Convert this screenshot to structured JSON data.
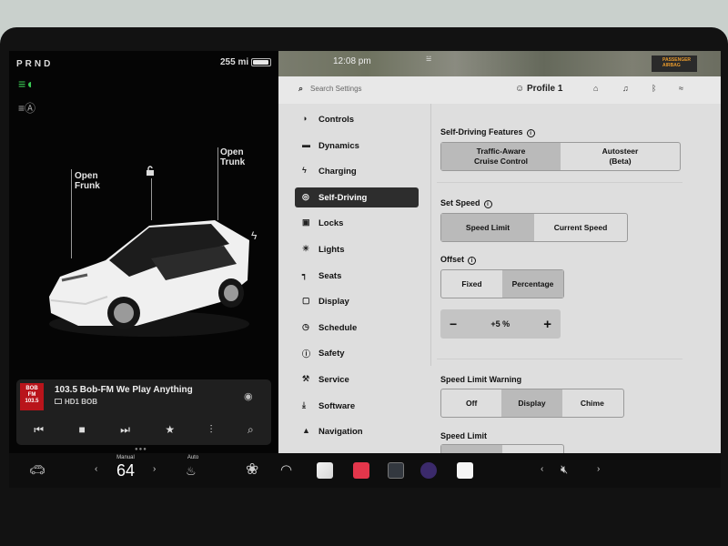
{
  "status": {
    "gear": "PRND",
    "range": "255 mi"
  },
  "car": {
    "open_frunk": "Open\nFrunk",
    "open_trunk": "Open\nTrunk"
  },
  "media": {
    "logo_text": "BOB\nFM\n103.5",
    "station": "103.5 Bob-FM We Play Anything",
    "sub": "HD1 BOB"
  },
  "map": {
    "time": "12:08 pm"
  },
  "airbag": "PASSENGER AIRBAG",
  "search": {
    "placeholder": "Search Settings"
  },
  "profile": "Profile 1",
  "nav": [
    {
      "label": "Controls",
      "icon": "toggle-icon"
    },
    {
      "label": "Dynamics",
      "icon": "car-icon"
    },
    {
      "label": "Charging",
      "icon": "bolt-icon"
    },
    {
      "label": "Self-Driving",
      "icon": "steering-wheel-icon"
    },
    {
      "label": "Locks",
      "icon": "lock-icon"
    },
    {
      "label": "Lights",
      "icon": "sun-icon"
    },
    {
      "label": "Seats",
      "icon": "seat-icon"
    },
    {
      "label": "Display",
      "icon": "display-icon"
    },
    {
      "label": "Schedule",
      "icon": "clock-icon"
    },
    {
      "label": "Safety",
      "icon": "info-icon"
    },
    {
      "label": "Service",
      "icon": "wrench-icon"
    },
    {
      "label": "Software",
      "icon": "download-icon"
    },
    {
      "label": "Navigation",
      "icon": "navigation-icon"
    }
  ],
  "self_driving": {
    "features_label": "Self-Driving Features",
    "features_options": [
      "Traffic-Aware\nCruise Control",
      "Autosteer\n(Beta)"
    ],
    "features_selected": "Traffic-Aware\nCruise Control",
    "set_speed_label": "Set Speed",
    "set_speed_options": [
      "Speed Limit",
      "Current Speed"
    ],
    "set_speed_selected": "Speed Limit",
    "offset_label": "Offset",
    "offset_options": [
      "Fixed",
      "Percentage"
    ],
    "offset_selected": "Percentage",
    "offset_value": "+5 %",
    "minus": "−",
    "plus": "+",
    "speed_limit_warning_label": "Speed Limit Warning",
    "speed_limit_warning_options": [
      "Off",
      "Display",
      "Chime"
    ],
    "speed_limit_warning_selected": "Display",
    "speed_limit_label": "Speed Limit"
  },
  "bottom_bar": {
    "climate_mode": "Manual",
    "temperature": "64",
    "seat_heat_mode": "Auto"
  },
  "colors": {
    "active_nav": "#2d2d2d",
    "settings_bg": "#dedede",
    "headlight": "#3bcc55",
    "station_logo": "#b9141b"
  }
}
